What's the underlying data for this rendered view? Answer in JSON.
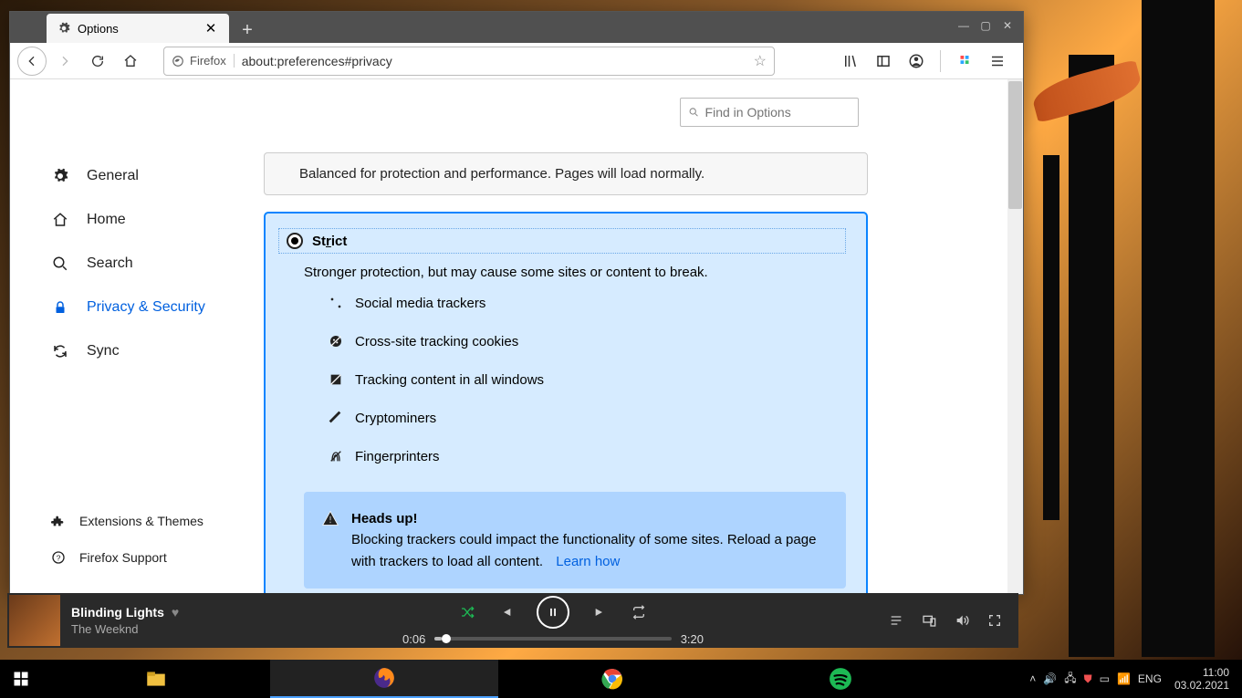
{
  "browser": {
    "tab_title": "Options",
    "url_identity": "Firefox",
    "url": "about:preferences#privacy",
    "search_placeholder": "Find in Options"
  },
  "sidebar": {
    "items": [
      {
        "label": "General"
      },
      {
        "label": "Home"
      },
      {
        "label": "Search"
      },
      {
        "label": "Privacy & Security"
      },
      {
        "label": "Sync"
      }
    ],
    "footer": [
      {
        "label": "Extensions & Themes"
      },
      {
        "label": "Firefox Support"
      }
    ]
  },
  "privacy": {
    "standard_desc": "Balanced for protection and performance. Pages will load normally.",
    "strict_label_pre": "St",
    "strict_label_u": "r",
    "strict_label_post": "ict",
    "strict_desc": "Stronger protection, but may cause some sites or content to break.",
    "block_items": [
      "Social media trackers",
      "Cross-site tracking cookies",
      "Tracking content in all windows",
      "Cryptominers",
      "Fingerprinters"
    ],
    "heads_up_title": "Heads up!",
    "heads_up_body": "Blocking trackers could impact the functionality of some sites. Reload a page with trackers to load all content.",
    "learn_how": "Learn how"
  },
  "player": {
    "track": "Blinding Lights",
    "artist": "The Weeknd",
    "elapsed": "0:06",
    "total": "3:20"
  },
  "system": {
    "lang": "ENG",
    "time": "11:00",
    "date": "03.02.2021"
  }
}
